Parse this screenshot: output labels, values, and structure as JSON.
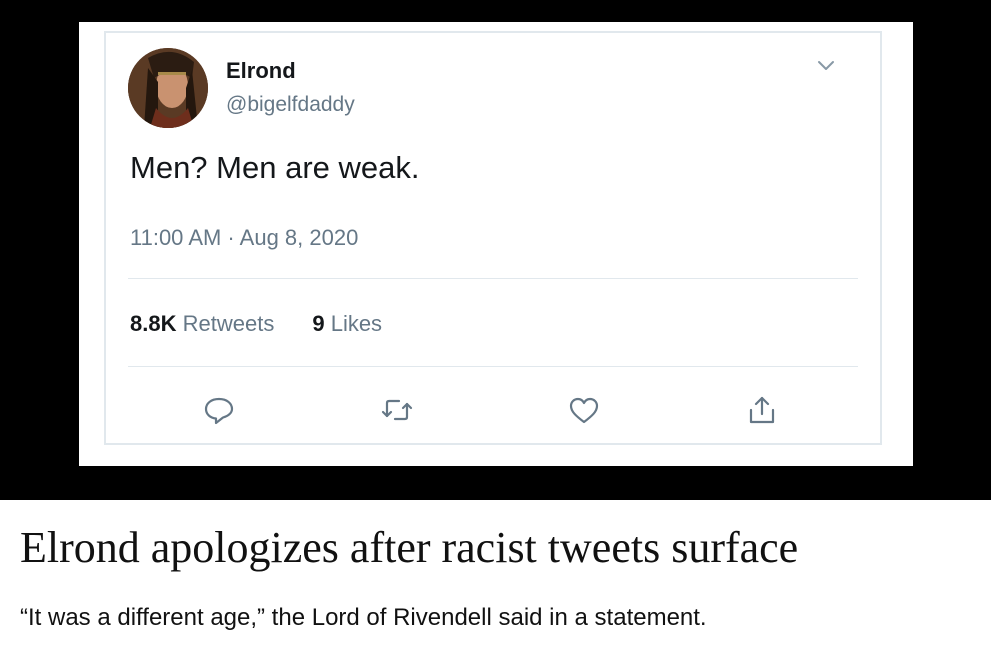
{
  "tweet": {
    "display_name": "Elrond",
    "handle": "@bigelfdaddy",
    "text": "Men? Men are weak.",
    "timestamp": "11:00 AM · Aug 8, 2020",
    "retweets_count": "8.8K",
    "retweets_label": "Retweets",
    "likes_count": "9",
    "likes_label": "Likes",
    "icons": {
      "menu": "chevron-down-icon",
      "reply": "reply-icon",
      "retweet": "retweet-icon",
      "like": "heart-icon",
      "share": "share-icon"
    }
  },
  "article": {
    "headline": "Elrond apologizes after racist tweets surface",
    "subhead": "“It was a different age,” the Lord of Rivendell said in a statement."
  },
  "colors": {
    "background": "#000000",
    "secondary_text": "#657786",
    "primary_text": "#14171a",
    "border": "#e1e8ed"
  }
}
